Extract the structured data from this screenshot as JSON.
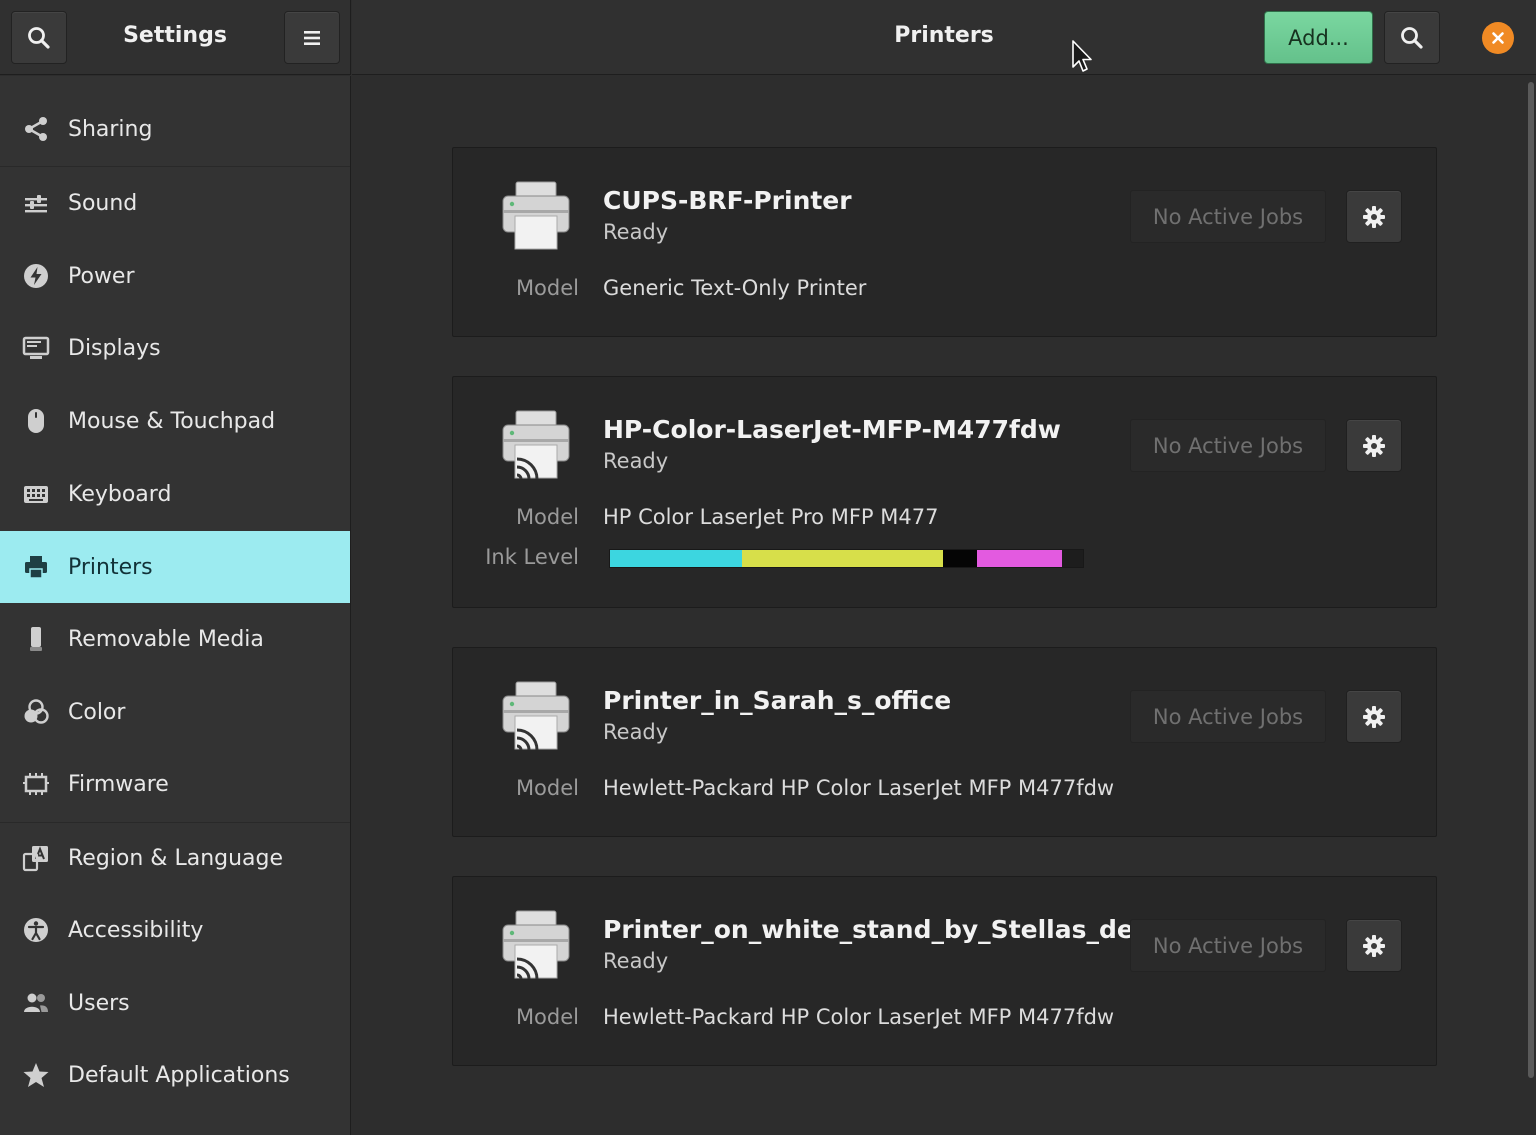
{
  "window": {
    "sidebar_title": "Settings",
    "main_title": "Printers",
    "add_button_label": "Add..."
  },
  "sidebar": {
    "items": [
      {
        "label": "Sharing",
        "icon": "share-icon"
      },
      {
        "label": "Sound",
        "icon": "sound-sliders-icon"
      },
      {
        "label": "Power",
        "icon": "power-bolt-icon"
      },
      {
        "label": "Displays",
        "icon": "display-icon"
      },
      {
        "label": "Mouse & Touchpad",
        "icon": "mouse-icon"
      },
      {
        "label": "Keyboard",
        "icon": "keyboard-icon"
      },
      {
        "label": "Printers",
        "icon": "printer-icon",
        "active": true
      },
      {
        "label": "Removable Media",
        "icon": "removable-media-icon"
      },
      {
        "label": "Color",
        "icon": "color-icon"
      },
      {
        "label": "Firmware",
        "icon": "chip-icon"
      },
      {
        "label": "Region & Language",
        "icon": "language-icon"
      },
      {
        "label": "Accessibility",
        "icon": "accessibility-icon"
      },
      {
        "label": "Users",
        "icon": "users-icon"
      },
      {
        "label": "Default Applications",
        "icon": "star-icon"
      }
    ]
  },
  "printers": [
    {
      "name": "CUPS-BRF-Printer",
      "status": "Ready",
      "model_label": "Model",
      "model": "Generic Text-Only Printer",
      "jobs": "No Active Jobs",
      "network": false
    },
    {
      "name": "HP-Color-LaserJet-MFP-M477fdw",
      "status": "Ready",
      "model_label": "Model",
      "model": "HP Color LaserJet Pro MFP M477",
      "jobs": "No Active Jobs",
      "network": true,
      "ink_label": "Ink Level",
      "ink_levels": [
        {
          "color": "cyan",
          "hex": "#3cd6e0",
          "fraction": 0.28
        },
        {
          "color": "yellow",
          "hex": "#d7df4a",
          "fraction": 0.425
        },
        {
          "color": "black",
          "hex": "#050505",
          "fraction": 0.07
        },
        {
          "color": "magenta",
          "hex": "#e35ae0",
          "fraction": 0.18
        }
      ]
    },
    {
      "name": "Printer_in_Sarah_s_office",
      "status": "Ready",
      "model_label": "Model",
      "model": "Hewlett-Packard HP Color LaserJet MFP M477fdw",
      "jobs": "No Active Jobs",
      "network": true
    },
    {
      "name": "Printer_on_white_stand_by_Stellas_desk",
      "status": "Ready",
      "model_label": "Model",
      "model": "Hewlett-Packard HP Color LaserJet MFP M477fdw",
      "jobs": "No Active Jobs",
      "network": true
    }
  ],
  "colors": {
    "accent_active": "#9cebf0",
    "add_button": "#6fcf97",
    "close_button": "#f08a24"
  }
}
